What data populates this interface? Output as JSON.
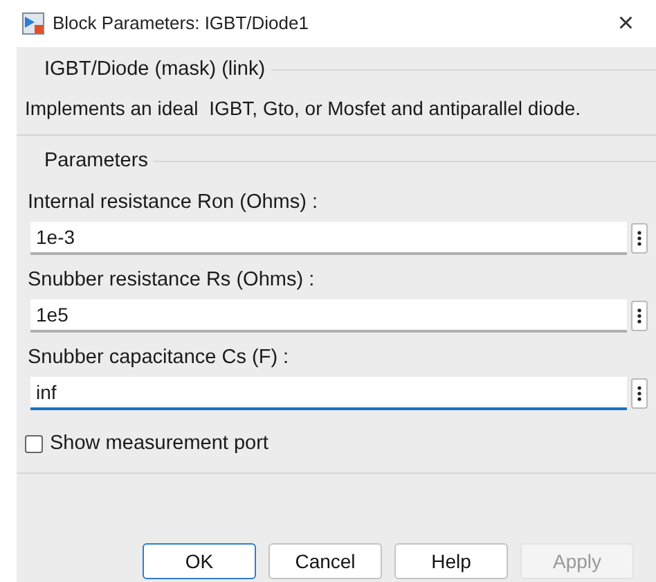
{
  "window": {
    "title": "Block Parameters: IGBT/Diode1",
    "close": "×"
  },
  "mask": {
    "title": "IGBT/Diode (mask) (link)",
    "description": "Implements an ideal  IGBT, Gto, or Mosfet and antiparallel diode."
  },
  "parameters": {
    "title": "Parameters",
    "fields": [
      {
        "label": "Internal resistance Ron (Ohms) :",
        "value": "1e-3",
        "focused": false
      },
      {
        "label": "Snubber resistance Rs (Ohms) :",
        "value": "1e5",
        "focused": false
      },
      {
        "label": "Snubber capacitance Cs (F) :",
        "value": "inf",
        "focused": true
      }
    ],
    "checkbox": {
      "label": "Show measurement port",
      "checked": false
    }
  },
  "buttons": [
    {
      "label": "OK",
      "disabled": false,
      "default": true
    },
    {
      "label": "Cancel",
      "disabled": false,
      "default": false
    },
    {
      "label": "Help",
      "disabled": false,
      "default": false
    },
    {
      "label": "Apply",
      "disabled": true,
      "default": false
    }
  ]
}
